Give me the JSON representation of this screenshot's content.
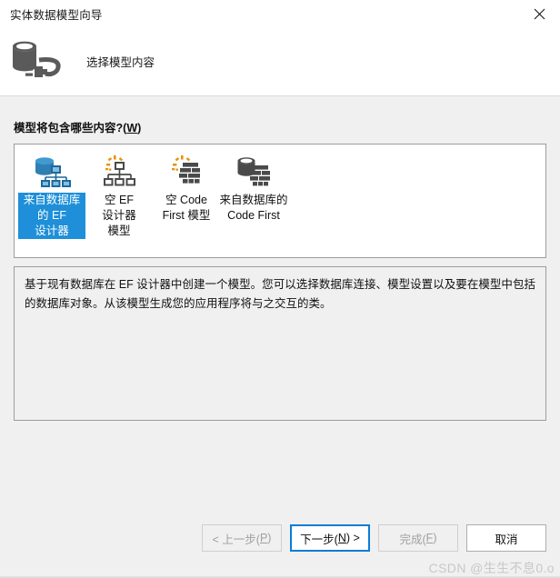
{
  "window": {
    "title": "实体数据模型向导",
    "close_icon": "close-icon"
  },
  "header": {
    "icon": "database-connection-icon",
    "title": "选择模型内容"
  },
  "main": {
    "prompt_label": "模型将包含哪些内容?(",
    "prompt_accesskey": "W",
    "prompt_label_end": ")",
    "templates": [
      {
        "label_line1": "来自数据库",
        "label_line2": "的 EF 设计器",
        "icon": "database-ef-designer-icon",
        "selected": true
      },
      {
        "label_line1": "空 EF 设计器",
        "label_line2": "模型",
        "icon": "empty-ef-designer-model-icon",
        "selected": false
      },
      {
        "label_line1": "空 Code",
        "label_line2": "First 模型",
        "icon": "empty-code-first-model-icon",
        "selected": false
      },
      {
        "label_line1": "来自数据库的",
        "label_line2": "Code First",
        "icon": "database-code-first-icon",
        "selected": false
      }
    ],
    "description": "基于现有数据库在 EF 设计器中创建一个模型。您可以选择数据库连接、模型设置以及要在模型中包括的数据库对象。从该模型生成您的应用程序将与之交互的类。"
  },
  "footer": {
    "buttons": [
      {
        "prefix": "< 上一步(",
        "accesskey": "P",
        "suffix": ")",
        "state": "disabled",
        "name": "back-button"
      },
      {
        "prefix": "下一步(",
        "accesskey": "N",
        "suffix": ") >",
        "state": "default",
        "name": "next-button"
      },
      {
        "prefix": "完成(",
        "accesskey": "F",
        "suffix": ")",
        "state": "disabled",
        "name": "finish-button"
      },
      {
        "prefix": "取消",
        "accesskey": "",
        "suffix": "",
        "state": "normal",
        "name": "cancel-button"
      }
    ]
  },
  "watermark": "CSDN @生生不息0.o",
  "colors": {
    "selection_blue": "#1e8fd8",
    "focus_border_blue": "#0c7cd5",
    "dialog_background": "#f0f0f0",
    "panel_white": "#ffffff",
    "icon_dark": "#4a4a4a",
    "icon_accent_orange": "#e8920a",
    "icon_blue": "#2e8bc9"
  }
}
